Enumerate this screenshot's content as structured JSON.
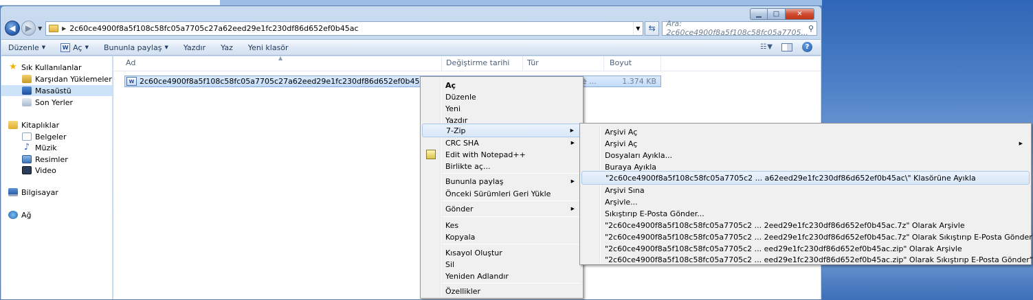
{
  "window": {
    "buttons": {
      "minimize": "▁",
      "maximize": "□",
      "close": "✕"
    }
  },
  "address": {
    "path": "2c60ce4900f8a5f108c58fc05a7705c27a62eed29e1fc230df86d652ef0b45ac",
    "search_placeholder": "Ara: 2c60ce4900f8a5f108c58fc05a7705..."
  },
  "toolbar": {
    "organize": "Düzenle",
    "open": "Aç",
    "share": "Bununla paylaş",
    "print": "Yazdır",
    "burn": "Yaz",
    "new_folder": "Yeni klasör"
  },
  "nav": {
    "favorites": "Sık Kullanılanlar",
    "downloads": "Karşıdan Yüklemeler",
    "desktop": "Masaüstü",
    "recent": "Son Yerler",
    "libraries": "Kitaplıklar",
    "documents": "Belgeler",
    "music": "Müzik",
    "pictures": "Resimler",
    "videos": "Video",
    "computer": "Bilgisayar",
    "network": "Ağ"
  },
  "columns": {
    "name": "Ad",
    "date": "Değiştirme tarihi",
    "type": "Tür",
    "size": "Boyut"
  },
  "file": {
    "name": "2c60ce4900f8a5f108c58fc05a7705c27a62eed29e1fc230df86d652ef0b45ac.docm",
    "type": "Microsoft Office ...",
    "size": "1.374 KB"
  },
  "context_menu": {
    "open": "Aç",
    "edit": "Düzenle",
    "new": "Yeni",
    "print": "Yazdır",
    "sevenzip": "7-Zip",
    "crc": "CRC SHA",
    "notepad": "Edit with Notepad++",
    "open_with": "Birlikte aç...",
    "share": "Bununla paylaş",
    "restore": "Önceki Sürümleri Geri Yükle",
    "send_to": "Gönder",
    "cut": "Kes",
    "copy": "Kopyala",
    "shortcut": "Kısayol Oluştur",
    "delete": "Sil",
    "rename": "Yeniden Adlandır",
    "properties": "Özellikler"
  },
  "submenu": {
    "open_archive": "Arşivi Aç",
    "open_archive2": "Arşivi Aç",
    "extract_files": "Dosyaları Ayıkla...",
    "extract_here": "Buraya Ayıkla",
    "extract_to": "\"2c60ce4900f8a5f108c58fc05a7705c2 ... a62eed29e1fc230df86d652ef0b45ac\\\" Klasörüne Ayıkla",
    "test": "Arşivi Sına",
    "add": "Arşivle...",
    "compress_email": "Sıkıştırıp E-Posta Gönder...",
    "add_7z": "\"2c60ce4900f8a5f108c58fc05a7705c2 ... 2eed29e1fc230df86d652ef0b45ac.7z\" Olarak Arşivle",
    "email_7z": "\"2c60ce4900f8a5f108c58fc05a7705c2 ... 2eed29e1fc230df86d652ef0b45ac.7z\" Olarak Sıkıştırıp E-Posta Gönder\"",
    "add_zip": "\"2c60ce4900f8a5f108c58fc05a7705c2 ... eed29e1fc230df86d652ef0b45ac.zip\" Olarak Arşivle",
    "email_zip": "\"2c60ce4900f8a5f108c58fc05a7705c2 ... eed29e1fc230df86d652ef0b45ac.zip\" Olarak Sıkıştırıp E-Posta Gönder\""
  }
}
